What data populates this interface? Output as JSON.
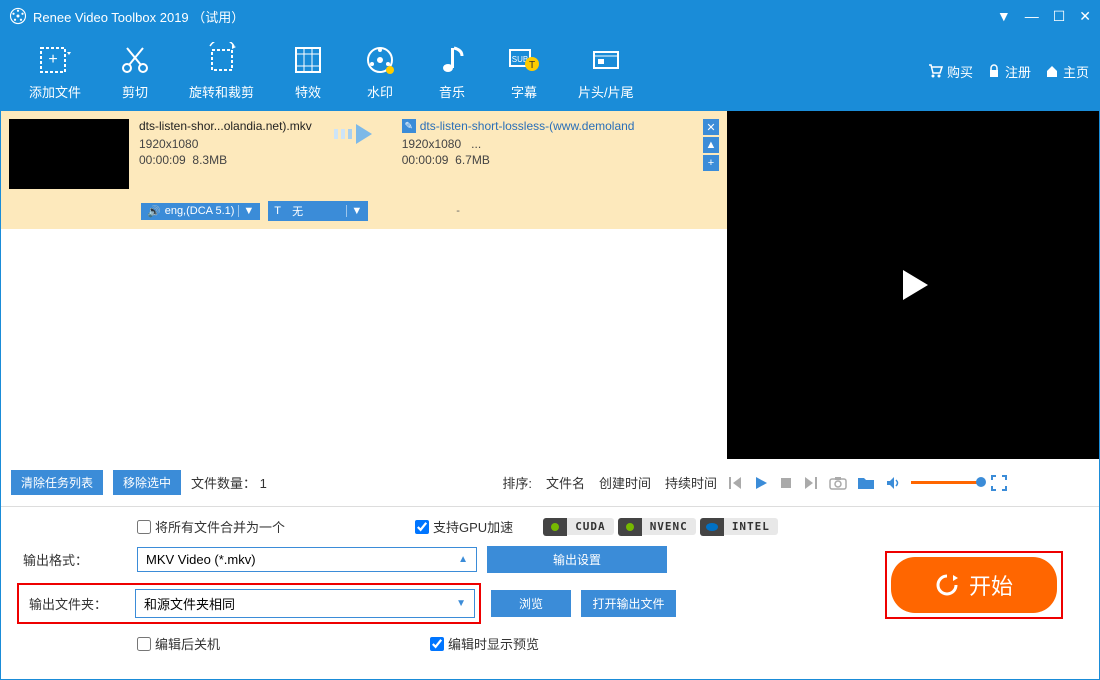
{
  "titlebar": {
    "title": "Renee Video Toolbox 2019 （试用）"
  },
  "toolbar": {
    "add_file": "添加文件",
    "cut": "剪切",
    "rotate_crop": "旋转和裁剪",
    "effects": "特效",
    "watermark": "水印",
    "music": "音乐",
    "subtitle": "字幕",
    "intro_outro": "片头/片尾",
    "buy": "购买",
    "register": "注册",
    "home": "主页"
  },
  "task": {
    "source_name": "dts-listen-shor...olandia.net).mkv",
    "source_res": "1920x1080",
    "source_dur": "00:00:09",
    "source_size": "8.3MB",
    "dest_name": "dts-listen-short-lossless-(www.demoland",
    "dest_res": "1920x1080",
    "dest_ellipsis": "...",
    "dest_dur": "00:00:09",
    "dest_size": "6.7MB",
    "audio_tag": "eng,(DCA 5.1)",
    "sub_tag_prefix": "T",
    "sub_tag": "无",
    "dash": "-"
  },
  "controls": {
    "clear_list": "清除任务列表",
    "remove_selected": "移除选中",
    "file_count_label": "文件数量：",
    "file_count": "1",
    "sort_label": "排序:",
    "sort_filename": "文件名",
    "sort_created": "创建时间",
    "sort_duration": "持续时间"
  },
  "options": {
    "merge_all": "将所有文件合并为一个",
    "gpu_accel": "支持GPU加速",
    "cuda": "CUDA",
    "nvenc": "NVENC",
    "intel": "INTEL",
    "output_format_label": "输出格式：",
    "output_format": "MKV Video (*.mkv)",
    "output_settings": "输出设置",
    "output_folder_label": "输出文件夹：",
    "output_folder": "和源文件夹相同",
    "browse": "浏览",
    "open_output": "打开输出文件",
    "shutdown_after": "编辑后关机",
    "preview_while": "编辑时显示预览",
    "start": "开始"
  }
}
